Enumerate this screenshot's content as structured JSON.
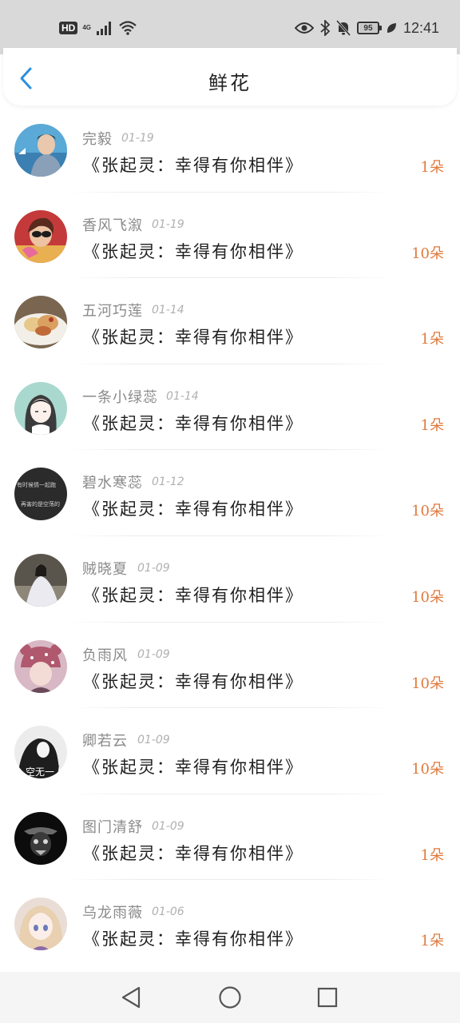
{
  "status_bar": {
    "hd": "HD",
    "network": "4G",
    "battery": "95",
    "battery_level": 0.95,
    "time": "12:41"
  },
  "header": {
    "title": "鲜花",
    "back_icon": "chevron-left-icon"
  },
  "colors": {
    "accent": "#2b8fe0",
    "amount": "#e07a3c",
    "name": "#8a8a8a",
    "date": "#b0b0b0"
  },
  "items": [
    {
      "name": "完毅",
      "date": "01-19",
      "book": "《张起灵：幸得有你相伴》",
      "amount": "1朵"
    },
    {
      "name": "香风飞溆",
      "date": "01-19",
      "book": "《张起灵：幸得有你相伴》",
      "amount": "10朵"
    },
    {
      "name": "五河巧莲",
      "date": "01-14",
      "book": "《张起灵：幸得有你相伴》",
      "amount": "1朵"
    },
    {
      "name": "一条小绿蕊",
      "date": "01-14",
      "book": "《张起灵：幸得有你相伴》",
      "amount": "1朵"
    },
    {
      "name": "碧水寒蕊",
      "date": "01-12",
      "book": "《张起灵：幸得有你相伴》",
      "amount": "10朵"
    },
    {
      "name": "贼晓夏",
      "date": "01-09",
      "book": "《张起灵：幸得有你相伴》",
      "amount": "10朵"
    },
    {
      "name": "负雨风",
      "date": "01-09",
      "book": "《张起灵：幸得有你相伴》",
      "amount": "10朵"
    },
    {
      "name": "卿若云",
      "date": "01-09",
      "book": "《张起灵：幸得有你相伴》",
      "amount": "10朵"
    },
    {
      "name": "图门清舒",
      "date": "01-09",
      "book": "《张起灵：幸得有你相伴》",
      "amount": "1朵"
    },
    {
      "name": "乌龙雨薇",
      "date": "01-06",
      "book": "《张起灵：幸得有你相伴》",
      "amount": "1朵"
    }
  ],
  "avatar_texts": {
    "a5_line1": "有时候情一起跑",
    "a5_line2": "再害的是空荡的",
    "a8": "空无一人"
  },
  "nav": {
    "back_icon": "triangle-back-icon",
    "home_icon": "circle-home-icon",
    "recents_icon": "square-recents-icon"
  }
}
